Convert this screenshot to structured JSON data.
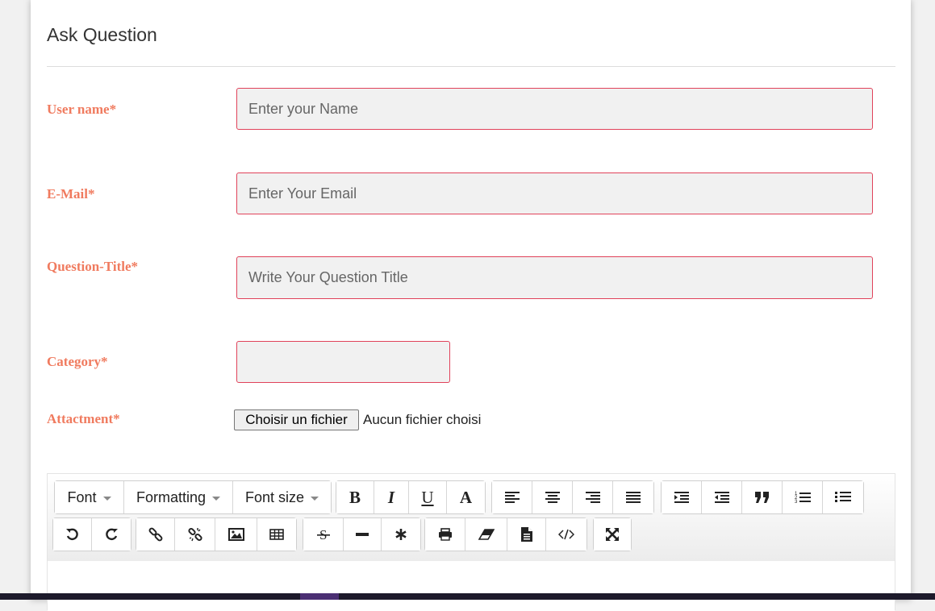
{
  "page": {
    "title": "Ask Question"
  },
  "form": {
    "username": {
      "label": "User name*",
      "placeholder": "Enter your Name"
    },
    "email": {
      "label": "E-Mail*",
      "placeholder": "Enter Your Email"
    },
    "question_title": {
      "label": "Question-Title*",
      "placeholder": "Write Your Question Title"
    },
    "category": {
      "label": "Category*",
      "value": ""
    },
    "attachment": {
      "label": "Attactment*",
      "button_label": "Choisir un fichier",
      "status": "Aucun fichier choisi"
    }
  },
  "editor": {
    "dropdowns": [
      "Font",
      "Formatting",
      "Font size"
    ],
    "text_buttons": {
      "bold": "B",
      "italic": "I",
      "underline": "U",
      "color": "A"
    },
    "icons": [
      "align-left-icon",
      "align-center-icon",
      "align-right-icon",
      "align-justify-icon",
      "indent-icon",
      "outdent-icon",
      "blockquote-icon",
      "ordered-list-icon",
      "unordered-list-icon",
      "undo-icon",
      "redo-icon",
      "link-icon",
      "unlink-icon",
      "image-icon",
      "table-icon",
      "strikethrough-icon",
      "horizontal-rule-icon",
      "special-char-icon",
      "print-icon",
      "eraser-icon",
      "document-icon",
      "code-view-icon",
      "fullscreen-icon"
    ]
  },
  "colors": {
    "label": "#f07b5f",
    "input_border": "#e0425a",
    "input_bg": "#f1f1f1"
  }
}
